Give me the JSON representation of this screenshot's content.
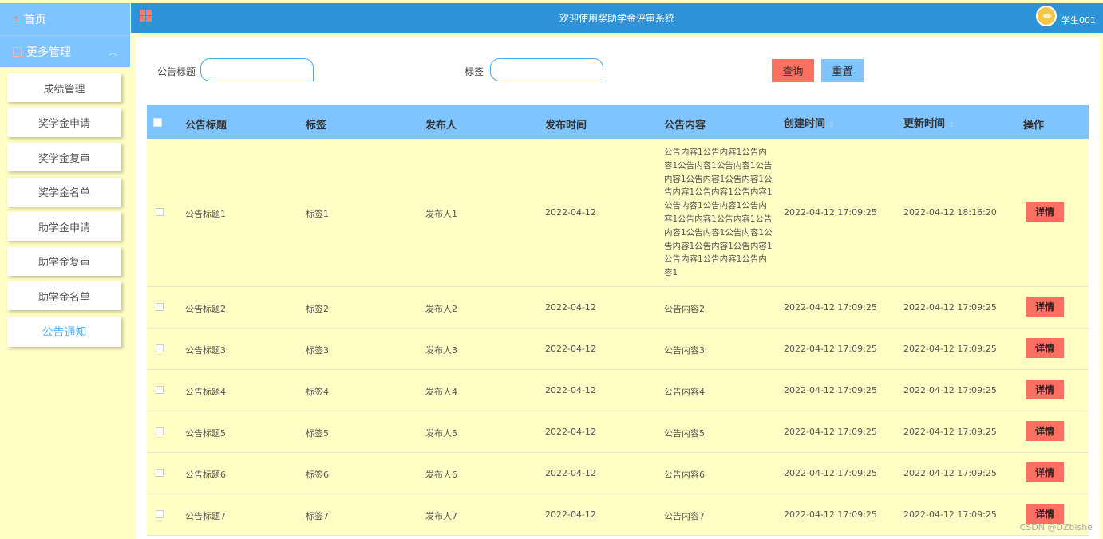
{
  "sidebar": {
    "home_label": "首页",
    "group_label": "更多管理",
    "items": [
      {
        "label": "成绩管理"
      },
      {
        "label": "奖学金申请"
      },
      {
        "label": "奖学金复审"
      },
      {
        "label": "奖学金名单"
      },
      {
        "label": "助学金申请"
      },
      {
        "label": "助学金复审"
      },
      {
        "label": "助学金名单"
      },
      {
        "label": "公告通知"
      }
    ]
  },
  "header": {
    "title": "欢迎使用奖助学金评审系统",
    "user": "学生001"
  },
  "search": {
    "title_label": "公告标题",
    "title_value": "",
    "tag_label": "标签",
    "tag_value": "",
    "query_button": "查询",
    "reset_button": "重置"
  },
  "table": {
    "columns": [
      "公告标题",
      "标签",
      "发布人",
      "发布时间",
      "公告内容",
      "创建时间",
      "更新时间",
      "操作"
    ],
    "detail_label": "详情",
    "rows": [
      {
        "title": "公告标题1",
        "tag": "标签1",
        "author": "发布人1",
        "date": "2022-04-12",
        "content": "公告内容1公告内容1公告内容1公告内容1公告内容1公告内容1公告内容1公告内容1公告内容1公告内容1公告内容1公告内容1公告内容1公告内容1公告内容1公告内容1公告内容1公告内容1公告内容1公告内容1公告内容1公告内容1公告内容1公告内容1公告内容1",
        "created": "2022-04-12 17:09:25",
        "updated": "2022-04-12 18:16:20"
      },
      {
        "title": "公告标题2",
        "tag": "标签2",
        "author": "发布人2",
        "date": "2022-04-12",
        "content": "公告内容2",
        "created": "2022-04-12 17:09:25",
        "updated": "2022-04-12 17:09:25"
      },
      {
        "title": "公告标题3",
        "tag": "标签3",
        "author": "发布人3",
        "date": "2022-04-12",
        "content": "公告内容3",
        "created": "2022-04-12 17:09:25",
        "updated": "2022-04-12 17:09:25"
      },
      {
        "title": "公告标题4",
        "tag": "标签4",
        "author": "发布人4",
        "date": "2022-04-12",
        "content": "公告内容4",
        "created": "2022-04-12 17:09:25",
        "updated": "2022-04-12 17:09:25"
      },
      {
        "title": "公告标题5",
        "tag": "标签5",
        "author": "发布人5",
        "date": "2022-04-12",
        "content": "公告内容5",
        "created": "2022-04-12 17:09:25",
        "updated": "2022-04-12 17:09:25"
      },
      {
        "title": "公告标题6",
        "tag": "标签6",
        "author": "发布人6",
        "date": "2022-04-12",
        "content": "公告内容6",
        "created": "2022-04-12 17:09:25",
        "updated": "2022-04-12 17:09:25"
      },
      {
        "title": "公告标题7",
        "tag": "标签7",
        "author": "发布人7",
        "date": "2022-04-12",
        "content": "公告内容7",
        "created": "2022-04-12 17:09:25",
        "updated": "2022-04-12 17:09:25"
      }
    ]
  },
  "watermark": "CSDN @DZbishe",
  "colors": {
    "header_blue": "#2e93d9",
    "light_blue": "#7fc3ff",
    "row_yellow": "#fffec4",
    "accent_red": "#fc6f61"
  }
}
